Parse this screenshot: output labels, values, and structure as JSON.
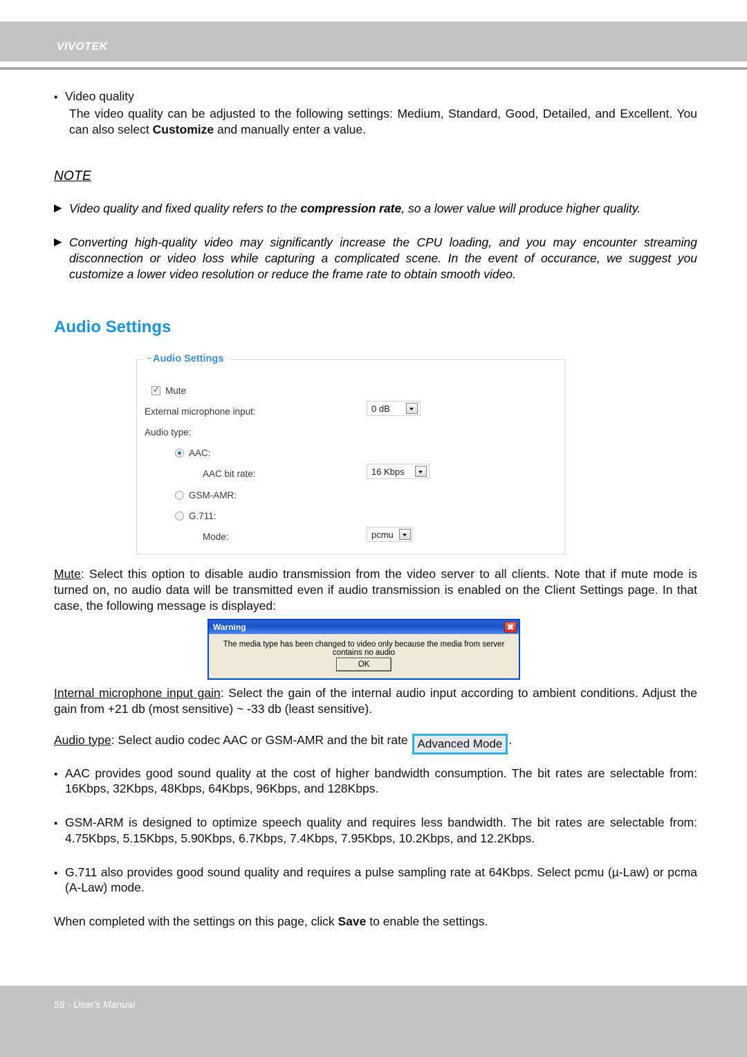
{
  "header": {
    "brand": "VIVOTEK"
  },
  "footer": {
    "text": "58 - User's Manual"
  },
  "video_quality": {
    "bullet_label": "Video quality",
    "body_part1": "The video quality can be adjusted to the following settings: Medium, Standard, Good, Detailed, and Excellent. You can also select ",
    "body_bold": "Customize",
    "body_part2": " and manually enter a value."
  },
  "note": {
    "title": "NOTE",
    "items": [
      {
        "part1": "Video quality and fixed quality refers to the ",
        "bold": "compression rate",
        "part2": ", so a lower value will produce higher quality."
      },
      {
        "part1": "Converting high-quality video may significantly increase the CPU loading, and you may encounter streaming disconnection or video loss while capturing a complicated scene. In the event of occurance, we suggest you customize a lower video resolution or reduce the frame rate to obtain smooth video.",
        "bold": "",
        "part2": ""
      }
    ]
  },
  "section": {
    "heading": "Audio Settings"
  },
  "audio_panel": {
    "legend": "Audio Settings",
    "collapse_icon": "minus-icon",
    "mute": {
      "label": "Mute",
      "checked": true
    },
    "external_mic": {
      "label": "External microphone input:",
      "value": "0 dB"
    },
    "audio_type": {
      "label": "Audio type:"
    },
    "aac": {
      "label": "AAC:",
      "selected": true,
      "bitrate_label": "AAC bit rate:",
      "bitrate_value": "16 Kbps"
    },
    "gsm_amr": {
      "label": "GSM-AMR:",
      "selected": false
    },
    "g711": {
      "label": "G.711:",
      "selected": false,
      "mode_label": "Mode:",
      "mode_value": "pcmu"
    }
  },
  "mute_desc": {
    "term": "Mute",
    "body": ": Select this option to disable audio transmission from the video server to all clients. Note that if mute mode is turned on, no audio data will be transmitted even if audio transmission is enabled on the Client Settings page. In that case, the following message is displayed:"
  },
  "warning_dialog": {
    "title": "Warning",
    "close_icon": "close-icon",
    "message": "The media type has been changed to video only because the media from server contains no audio",
    "ok_label": "OK"
  },
  "internal_gain": {
    "term": "Internal microphone input gain",
    "body": ": Select the gain of the internal audio input according to ambient conditions. Adjust the gain from +21 db (most sensitive) ~ -33 db (least sensitive)."
  },
  "audio_type_desc": {
    "term": "Audio type",
    "body": ": Select audio codec AAC or GSM-AMR and the bit rate ",
    "badge": "Advanced Mode",
    "tail": "."
  },
  "codec_bullets": [
    "AAC provides good sound quality at the cost of higher bandwidth consumption. The bit rates are selectable from: 16Kbps, 32Kbps, 48Kbps, 64Kbps, 96Kbps, and 128Kbps.",
    "GSM-ARM is designed to optimize speech quality and requires less bandwidth. The bit rates are selectable from: 4.75Kbps, 5.15Kbps, 5.90Kbps, 6.7Kbps, 7.4Kbps, 7.95Kbps, 10.2Kbps, and 12.2Kbps.",
    "G.711 also provides good sound quality and requires a pulse sampling rate at 64Kbps. Select pcmu (µ-Law) or pcma (A-Law) mode."
  ],
  "closing": {
    "part1": "When completed with the settings on this page, click ",
    "bold": "Save",
    "part2": " to enable the settings."
  },
  "colors": {
    "brand_bar": "#c3c5c4",
    "heading_blue": "#1b95d8",
    "legend_blue": "#3a8fd6",
    "badge_border": "#29b4e8",
    "dialog_title": "#1b52c4"
  }
}
